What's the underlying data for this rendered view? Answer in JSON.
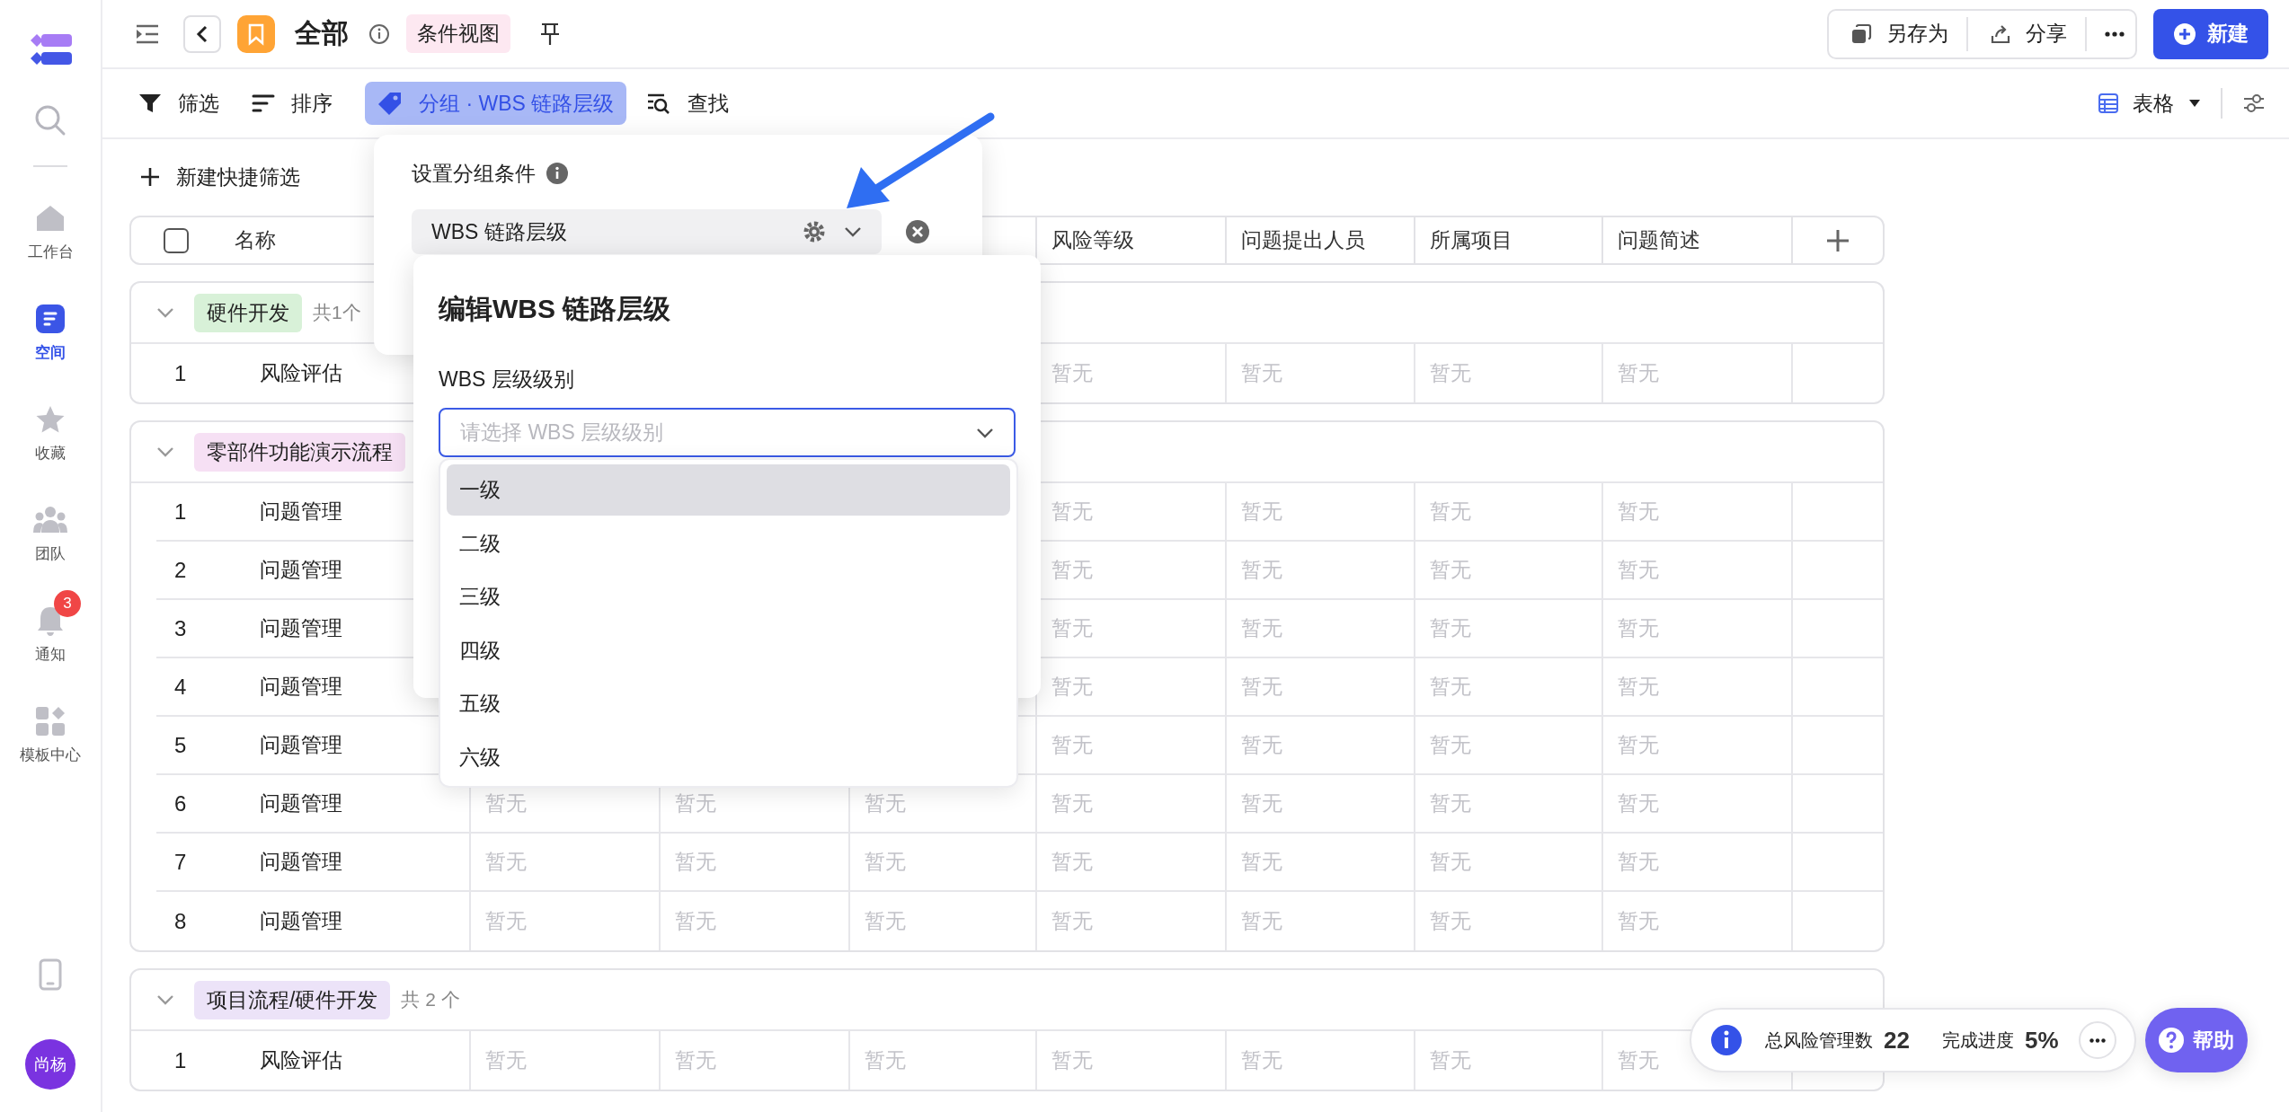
{
  "sidebar": {
    "items": [
      {
        "kind": "home",
        "label": "工作台",
        "selected": false
      },
      {
        "kind": "space",
        "label": "空间",
        "selected": true
      },
      {
        "kind": "star",
        "label": "收藏",
        "selected": false
      },
      {
        "kind": "team",
        "label": "团队",
        "selected": false
      },
      {
        "kind": "bell",
        "label": "通知",
        "selected": false,
        "badge": "3"
      },
      {
        "kind": "apps",
        "label": "模板中心",
        "selected": false
      }
    ],
    "avatar": "尚杨"
  },
  "header": {
    "title": "全部",
    "view_tag": "条件视图",
    "actions": [
      {
        "kind": "copy",
        "label": "另存为"
      },
      {
        "kind": "share",
        "label": "分享"
      }
    ],
    "new_button": "新建"
  },
  "toolbar": {
    "items": [
      {
        "kind": "filter",
        "label": "筛选",
        "selected": false
      },
      {
        "kind": "sort",
        "label": "排序",
        "selected": false
      },
      {
        "kind": "group",
        "label": "分组 · WBS 链路层级",
        "selected": true
      },
      {
        "kind": "find",
        "label": "查找",
        "selected": false
      }
    ],
    "view": "表格"
  },
  "quick_filter": "新建快捷筛选",
  "table": {
    "all_checked": false,
    "header": {
      "name": "名称",
      "risk_level": "风险等级",
      "reporter": "问题提出人员",
      "project": "所属项目",
      "summary": "问题简述"
    },
    "groups": [
      {
        "name": "硬件开发",
        "color": "#d8f1d8",
        "count": "共1个",
        "expanded": true,
        "rows": [
          {
            "no": "1",
            "name": "风险评估",
            "risk_level": "暂无",
            "reporter": "暂无",
            "project": "暂无",
            "summary": "暂无"
          }
        ]
      },
      {
        "name": "零部件功能演示流程",
        "color": "#f6e0f4",
        "expanded": true,
        "rows": [
          {
            "no": "1",
            "name": "问题管理",
            "risk_level": "暂无",
            "reporter": "暂无",
            "project": "暂无",
            "summary": "暂无"
          },
          {
            "no": "2",
            "name": "问题管理",
            "risk_level": "暂无",
            "reporter": "暂无",
            "project": "暂无",
            "summary": "暂无"
          },
          {
            "no": "3",
            "name": "问题管理",
            "risk_level": "暂无",
            "reporter": "暂无",
            "project": "暂无",
            "summary": "暂无"
          },
          {
            "no": "4",
            "name": "问题管理",
            "risk_level": "暂无",
            "reporter": "暂无",
            "project": "暂无",
            "summary": "暂无"
          },
          {
            "no": "5",
            "name": "问题管理",
            "risk_level": "暂无",
            "reporter": "暂无",
            "project": "暂无",
            "summary": "暂无"
          },
          {
            "no": "6",
            "name": "问题管理",
            "column_3": "暂无",
            "column_4": "暂无",
            "column_5": "暂无",
            "risk_level": "暂无",
            "reporter": "暂无",
            "project": "暂无",
            "summary": "暂无"
          },
          {
            "no": "7",
            "name": "问题管理",
            "column_3": "暂无",
            "column_4": "暂无",
            "column_5": "暂无",
            "risk_level": "暂无",
            "reporter": "暂无",
            "project": "暂无",
            "summary": "暂无"
          },
          {
            "no": "8",
            "name": "问题管理",
            "column_3": "暂无",
            "column_4": "暂无",
            "column_5": "暂无",
            "risk_level": "暂无",
            "reporter": "暂无",
            "project": "暂无",
            "summary": "暂无"
          }
        ]
      },
      {
        "name": "项目流程/硬件开发",
        "color": "#ece3f8",
        "count": "共 2 个",
        "expanded": true,
        "rows": [
          {
            "no": "1",
            "name": "风险评估",
            "column_3": "暂无",
            "column_4": "暂无",
            "column_5": "暂无",
            "risk_level": "暂无",
            "reporter": "暂无",
            "project": "暂无",
            "summary": "暂无"
          }
        ]
      }
    ]
  },
  "group_settings": {
    "title": "设置分组条件",
    "field": "WBS 链路层级"
  },
  "edit_panel": {
    "title": "编辑WBS 链路层级",
    "label": "WBS 层级级别",
    "placeholder": "请选择 WBS 层级级别",
    "options": [
      {
        "label": "一级",
        "highlighted": true
      },
      {
        "label": "二级",
        "highlighted": false
      },
      {
        "label": "三级",
        "highlighted": false
      },
      {
        "label": "四级",
        "highlighted": false
      },
      {
        "label": "五级",
        "highlighted": false
      },
      {
        "label": "六级",
        "highlighted": false
      }
    ]
  },
  "summary": {
    "items": [
      {
        "label": "总风险管理数",
        "value": "22"
      },
      {
        "label": "完成进度",
        "value": "5%"
      }
    ]
  },
  "help": "帮助"
}
